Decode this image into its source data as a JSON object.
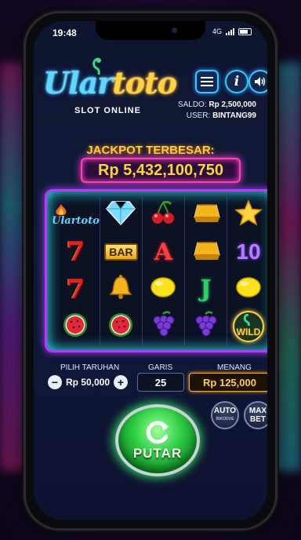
{
  "status_bar": {
    "time": "19:48",
    "network": "4G"
  },
  "brand": {
    "logo_part1": "Ular",
    "logo_part2": "toto",
    "subtitle": "SLOT ONLINE"
  },
  "account": {
    "balance_label": "SALDO:",
    "balance": "Rp 2,500,000",
    "user_label": "USER:",
    "user": "BINTANG99"
  },
  "jackpot": {
    "title": "JACKPOT TERBESAR:",
    "amount": "Rp 5,432,100,750"
  },
  "reels": [
    [
      "logo",
      "diamond",
      "cherry",
      "gold-bar",
      "star"
    ],
    [
      "seven",
      "bar",
      "A",
      "gold-bar",
      "10"
    ],
    [
      "seven",
      "bell",
      "lemon",
      "J",
      "lemon"
    ],
    [
      "watermelon",
      "watermelon",
      "grapes",
      "grapes",
      "wild"
    ]
  ],
  "symbols": {
    "bar": "BAR",
    "a": "A",
    "j": "J",
    "ten": "10",
    "seven": "7",
    "wild": "WILD",
    "logo_small": "Ulartoto"
  },
  "controls": {
    "bet_label": "PILIH TARUHAN",
    "bet_value": "Rp 50,000",
    "minus": "−",
    "plus": "+",
    "lines_label": "GARIS",
    "lines_value": "25",
    "win_label": "MENANG",
    "win_value": "Rp 125,000",
    "spin_label": "PUTAR",
    "auto_label": "AUTO",
    "auto_sub": "BIKODUE",
    "max_label": "MAX BET"
  },
  "colors": {
    "accent_blue": "#39c6ff",
    "accent_pink": "#ff3fc0",
    "gold": "#ffd23f",
    "spin_green": "#2fd044"
  }
}
